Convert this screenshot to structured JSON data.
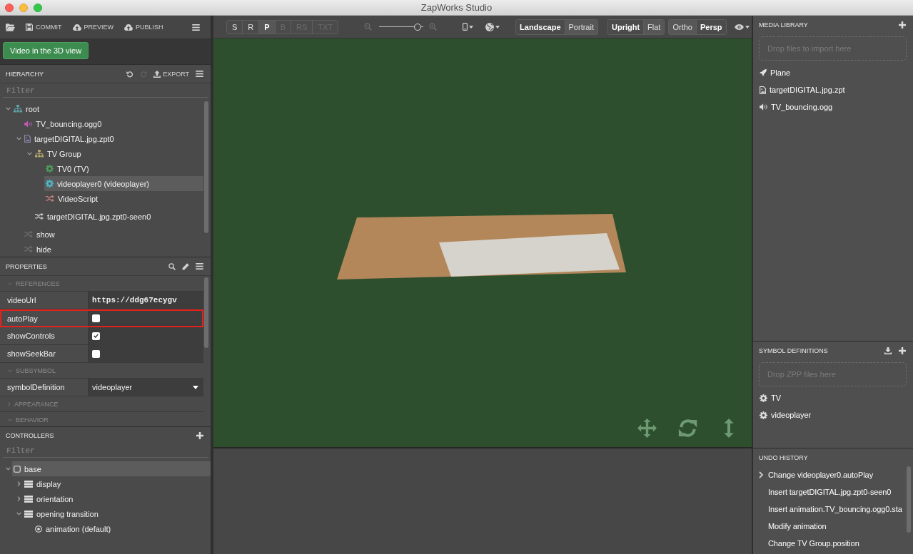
{
  "window": {
    "title": "ZapWorks Studio"
  },
  "project_toolbar": {
    "buttons": [
      "COMMIT",
      "PREVIEW",
      "PUBLISH"
    ]
  },
  "scene_button": "Video in the 3D view",
  "hierarchy": {
    "title": "HIERARCHY",
    "redo_disabled": true,
    "export": "EXPORT",
    "filter_placeholder": "Filter",
    "tree": [
      {
        "label": "root",
        "kind": "group",
        "color": "#5fa3ad",
        "expanded": true,
        "selected": false,
        "children": [
          {
            "label": "TV_bouncing.ogg0",
            "kind": "audio",
            "color": "#c25cb8",
            "selected": false
          },
          {
            "label": "targetDIGITAL.jpg.zpt0",
            "kind": "image",
            "color": "#8d89b3",
            "expanded": true,
            "selected": false,
            "children": [
              {
                "label": "TV Group",
                "kind": "group",
                "color": "#b4a86b",
                "expanded": true,
                "selected": false,
                "children": [
                  {
                    "label": "TV0 (TV)",
                    "kind": "symbol",
                    "color": "#4e9c5e",
                    "selected": false
                  },
                  {
                    "label": "videoplayer0 (videoplayer)",
                    "kind": "symbol",
                    "color": "#4fbac9",
                    "selected": true
                  },
                  {
                    "label": "VideoScript",
                    "kind": "script",
                    "color": "#c47b7b",
                    "selected": false
                  }
                ]
              },
              {
                "label": "targetDIGITAL.jpg.zpt0-seen0",
                "kind": "script",
                "color": "#c9c9c9",
                "selected": false
              }
            ]
          },
          {
            "label": "show",
            "kind": "script",
            "color": "#6b6b6b",
            "selected": false
          },
          {
            "label": "hide",
            "kind": "script",
            "color": "#6b6b6b",
            "selected": false
          }
        ]
      }
    ]
  },
  "properties": {
    "title": "PROPERTIES",
    "rows": [
      {
        "kind": "section",
        "label": "REFERENCES",
        "expanded": true
      },
      {
        "kind": "text",
        "label": "videoUrl",
        "value": "https://ddg67ecygv",
        "highlighted": false
      },
      {
        "kind": "checkbox",
        "label": "autoPlay",
        "checked": false,
        "highlighted": true
      },
      {
        "kind": "checkbox",
        "label": "showControls",
        "checked": true,
        "highlighted": false
      },
      {
        "kind": "checkbox",
        "label": "showSeekBar",
        "checked": false,
        "highlighted": false
      },
      {
        "kind": "section",
        "label": "SUBSYMBOL",
        "expanded": true
      },
      {
        "kind": "select",
        "label": "symbolDefinition",
        "value": "videoplayer",
        "highlighted": false
      },
      {
        "kind": "section",
        "label": "APPEARANCE",
        "expanded": false
      },
      {
        "kind": "section",
        "label": "BEHAVIOR",
        "expanded": true
      }
    ]
  },
  "controllers": {
    "title": "CONTROLLERS",
    "filter_placeholder": "Filter",
    "tree": [
      {
        "label": "base",
        "kind": "state",
        "expanded": true,
        "selected": true,
        "children": [
          {
            "label": "display",
            "kind": "group",
            "expanded": false,
            "selected": false
          },
          {
            "label": "orientation",
            "kind": "group",
            "expanded": false,
            "selected": false
          },
          {
            "label": "opening transition",
            "kind": "group",
            "expanded": true,
            "selected": false,
            "children": [
              {
                "label": "animation (default)",
                "kind": "animation",
                "selected": false
              }
            ]
          }
        ]
      }
    ]
  },
  "view_toolbar": {
    "modes": [
      {
        "label": "S",
        "selected": false,
        "disabled": false
      },
      {
        "label": "R",
        "selected": false,
        "disabled": false
      },
      {
        "label": "P",
        "selected": true,
        "disabled": false
      },
      {
        "label": "B",
        "selected": false,
        "disabled": true
      },
      {
        "label": "RS",
        "selected": false,
        "disabled": true
      },
      {
        "label": "TXT",
        "selected": false,
        "disabled": true
      }
    ],
    "zoom": {
      "level": 0.95
    },
    "orientation": [
      {
        "label": "Landscape",
        "selected": true
      },
      {
        "label": "Portrait",
        "selected": false
      }
    ],
    "pose": [
      {
        "label": "Upright",
        "selected": true
      },
      {
        "label": "Flat",
        "selected": false
      }
    ],
    "projection": [
      {
        "label": "Ortho",
        "selected": false
      },
      {
        "label": "Persp",
        "selected": true
      }
    ]
  },
  "media_library": {
    "title": "MEDIA LIBRARY",
    "drop_placeholder": "Drop files to import here",
    "items": [
      {
        "kind": "plane",
        "label": "Plane"
      },
      {
        "kind": "image",
        "label": "targetDIGITAL.jpg.zpt"
      },
      {
        "kind": "audio",
        "label": "TV_bouncing.ogg"
      }
    ]
  },
  "symbol_definitions": {
    "title": "SYMBOL DEFINITIONS",
    "drop_placeholder": "Drop ZPP files here",
    "items": [
      "TV",
      "videoplayer"
    ]
  },
  "undo_history": {
    "title": "UNDO HISTORY",
    "items": [
      {
        "label": "Change videoplayer0.autoPlay",
        "current": true
      },
      {
        "label": "Insert targetDIGITAL.jpg.zpt0-seen0",
        "current": false
      },
      {
        "label": "Insert animation.TV_bouncing.ogg0.sta",
        "current": false
      },
      {
        "label": "Modify animation",
        "current": false
      },
      {
        "label": "Change TV Group.position",
        "current": false
      }
    ]
  }
}
